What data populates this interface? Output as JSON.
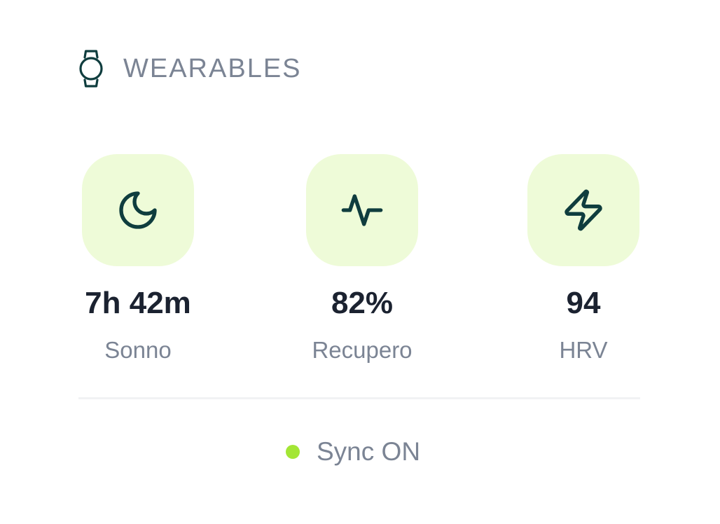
{
  "card": {
    "title": "WEARABLES",
    "icon": "watch-icon",
    "accent": "#a3e635",
    "tile_color": "#eefbd8",
    "icon_color": "#0f3d3e"
  },
  "metrics": [
    {
      "icon": "moon-icon",
      "value": "7h 42m",
      "label": "Sonno"
    },
    {
      "icon": "activity-icon",
      "value": "82%",
      "label": "Recupero"
    },
    {
      "icon": "lightning-icon",
      "value": "94",
      "label": "HRV"
    }
  ],
  "sync": {
    "label": "Sync ON",
    "status_color": "#a3e635"
  }
}
